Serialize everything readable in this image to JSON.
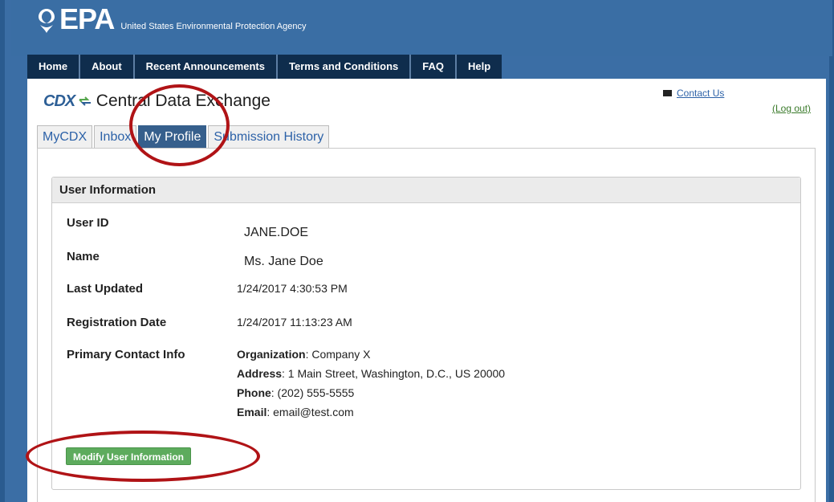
{
  "header": {
    "logo_text": "EPA",
    "agency_name": "United States Environmental Protection Agency"
  },
  "nav": {
    "items": [
      "Home",
      "About",
      "Recent Announcements",
      "Terms and Conditions",
      "FAQ",
      "Help"
    ]
  },
  "cdx": {
    "logo": "CDX",
    "title": "Central Data Exchange",
    "contact_link": "Contact Us",
    "logout_link": "(Log out)"
  },
  "tabs": [
    {
      "label": "MyCDX",
      "active": false
    },
    {
      "label": "Inbox",
      "active": false
    },
    {
      "label": "My Profile",
      "active": true
    },
    {
      "label": "Submission History",
      "active": false
    }
  ],
  "user_info": {
    "heading": "User Information",
    "user_id_label": "User ID",
    "user_id": "JANE.DOE",
    "name_label": "Name",
    "name": "Ms. Jane Doe",
    "last_updated_label": "Last Updated",
    "last_updated": "1/24/2017 4:30:53 PM",
    "registration_label": "Registration Date",
    "registration_date": "1/24/2017 11:13:23 AM",
    "primary_contact_label": "Primary Contact Info",
    "organization_label": "Organization",
    "organization": ": Company X",
    "address_label": "Address",
    "address": ": 1 Main Street, Washington, D.C., US 20000",
    "phone_label": "Phone",
    "phone": ": (202) 555-5555",
    "email_label": "Email",
    "email": ": email@test.com",
    "modify_button": "Modify User Information"
  },
  "colors": {
    "header_blue": "#3a6ea4",
    "nav_dark": "#0f2d4d",
    "active_tab": "#365f8c",
    "button_green": "#5dab5d",
    "annotation_red": "#b01316"
  }
}
